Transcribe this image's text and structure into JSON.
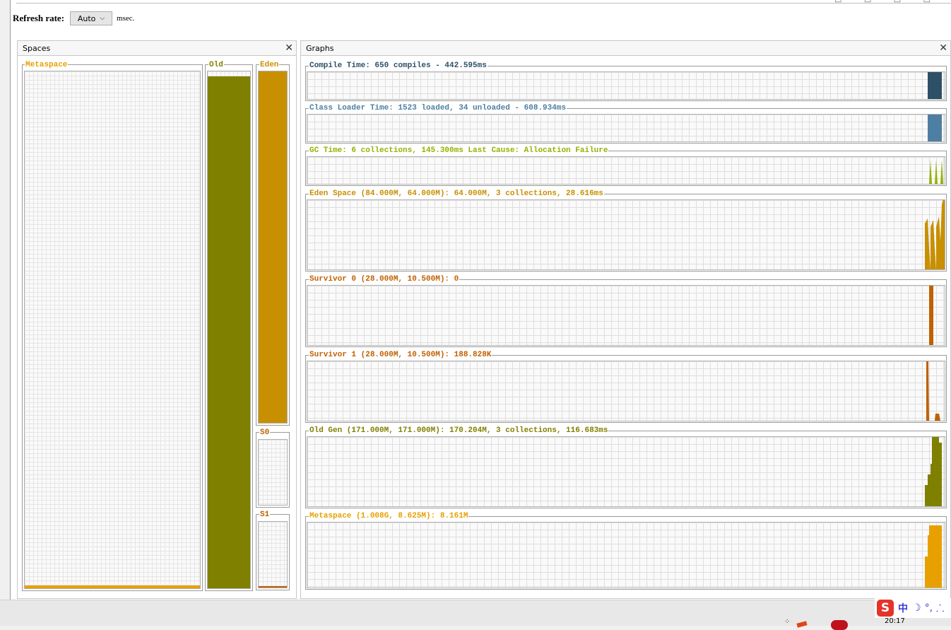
{
  "window": {
    "top_icons": "▭ ▭ ▭ ▭"
  },
  "refresh": {
    "label": "Refresh rate:",
    "selected": "Auto",
    "unit": "msec."
  },
  "spaces_panel": {
    "title": "Spaces",
    "close": "✕",
    "spaces": {
      "metaspace": {
        "label": "Metaspace",
        "color": "#e8a000",
        "fill_fraction": 0.006
      },
      "old": {
        "label": "Old",
        "color": "#808000",
        "fill_fraction": 0.99
      },
      "eden": {
        "label": "Eden",
        "color": "#c89000",
        "fill_fraction": 1.0
      },
      "s0": {
        "label": "S0",
        "color": "#c06000",
        "fill_fraction": 0.0
      },
      "s1": {
        "label": "S1",
        "color": "#c06000",
        "fill_fraction": 0.018
      }
    }
  },
  "graphs_panel": {
    "title": "Graphs",
    "close": "✕",
    "graphs": [
      {
        "label": "Compile Time: 650 compiles - 442.595ms",
        "color": "#2e5067"
      },
      {
        "label": "Class Loader Time: 1523 loaded, 34 unloaded - 608.934ms",
        "color": "#4e7fa2"
      },
      {
        "label": "GC Time: 6 collections, 145.300ms Last Cause: Allocation Failure",
        "color": "#98b000"
      },
      {
        "label": "Eden Space (84.000M, 64.000M): 64.000M, 3 collections, 28.616ms",
        "color": "#c89000"
      },
      {
        "label": "Survivor 0 (28.000M, 10.500M): 0",
        "color": "#c06000"
      },
      {
        "label": "Survivor 1 (28.000M, 10.500M): 188.828K",
        "color": "#c06000"
      },
      {
        "label": "Old Gen (171.000M, 171.000M): 170.204M, 3 collections, 116.683ms",
        "color": "#808000"
      },
      {
        "label": "Metaspace (1.008G, 8.625M): 8.161M",
        "color": "#e8a000"
      }
    ]
  },
  "taskbar": {
    "ime_logo": "S",
    "ime_lang": "中",
    "ime_moon": "☽",
    "ime_punct": "°,",
    "ime_extra": "⸫",
    "clock": "20:17",
    "tray_dots": "⁘"
  }
}
